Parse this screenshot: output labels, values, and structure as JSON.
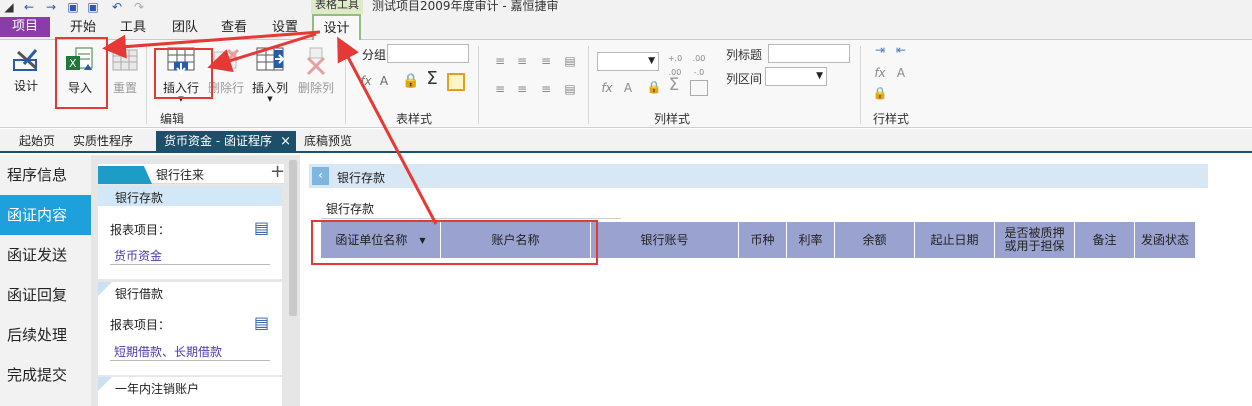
{
  "window": {
    "context_tab_title": "表格工具",
    "document_title": "测试项目2009年度审计 - 嘉恒捷审"
  },
  "ribbon_tabs": [
    "项目",
    "开始",
    "工具",
    "团队",
    "查看",
    "设置",
    "设计"
  ],
  "ribbon": {
    "design_label": "设计",
    "import_label": "导入",
    "reset_label": "重置",
    "insert_row_label": "插入行",
    "delete_row_label": "删除行",
    "insert_col_label": "插入列",
    "delete_col_label": "删除列",
    "group_edit": "编辑",
    "group_table_style": "表样式",
    "group_column_style": "列样式",
    "group_row_style": "行样式",
    "group_field_label": "分组",
    "column_title_label": "列标题",
    "column_interval_label": "列区间",
    "font_size_a": "A",
    "sum_symbol": "Σ",
    "fx_symbol": "fx",
    "decimals_increase": "+.0 .00",
    "decimals_decrease": ".00 -.0"
  },
  "doc_tabs": {
    "start": "起始页",
    "substantive": "实质性程序",
    "active": "货币资金 - 函证程序",
    "active_close": "×",
    "preview": "底稿预览"
  },
  "left_nav": [
    "程序信息",
    "函证内容",
    "函证发送",
    "函证回复",
    "后续处理",
    "完成提交"
  ],
  "mid_panel": {
    "header_tab": "银行往来",
    "add_symbol": "+",
    "cards": [
      {
        "title": "银行存款",
        "field_label": "报表项目：",
        "value": "货币资金"
      },
      {
        "title": "银行借款",
        "field_label": "报表项目：",
        "value": "短期借款、长期借款"
      },
      {
        "title": "一年内注销账户",
        "field_label": "",
        "value": ""
      }
    ]
  },
  "main": {
    "crumb": "银行存款",
    "section_title": "银行存款",
    "columns": [
      "函证单位名称",
      "账户名称",
      "银行账号",
      "币种",
      "利率",
      "余额",
      "起止日期",
      "是否被质押或用于担保",
      "备注",
      "发函状态"
    ]
  },
  "colors": {
    "accent_project": "#8a3da8",
    "nav_active": "#1ea0dc",
    "doc_tab_active": "#1b4f6a",
    "grid_header": "#9aa3cf",
    "annotation_red": "#e53935"
  }
}
